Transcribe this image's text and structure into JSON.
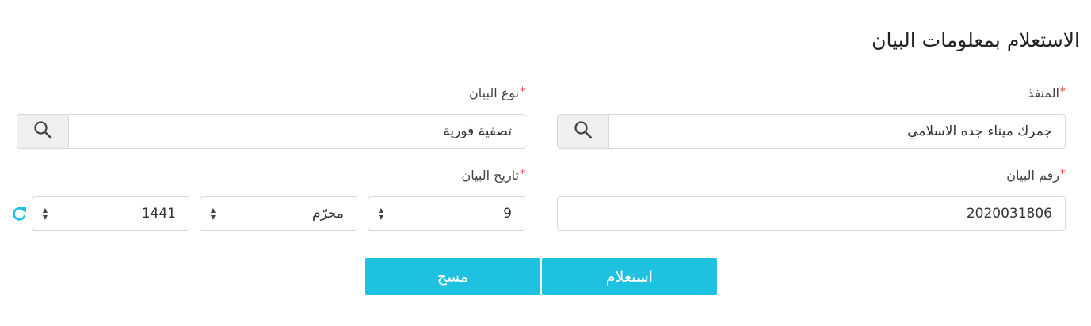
{
  "page": {
    "title": "الاستعلام بمعلومات البيان"
  },
  "port": {
    "label": "المنفذ",
    "required_mark": "*",
    "value": "جمرك ميناء جده الاسلامي"
  },
  "declaration_type": {
    "label": "نوع البيان",
    "required_mark": "*",
    "value": "تصفية فورية"
  },
  "declaration_number": {
    "label": "رقم البيان",
    "required_mark": "*",
    "value": "2020031806"
  },
  "declaration_date": {
    "label": "تاريخ البيان",
    "required_mark": "*",
    "day": "9",
    "month": "محرّم",
    "year": "1441"
  },
  "actions": {
    "inquiry_label": "استعلام",
    "clear_label": "مسح"
  },
  "colors": {
    "accent": "#1fc1e0",
    "required": "#e0453f"
  },
  "icons": [
    "search-icon",
    "refresh-icon",
    "spinner-arrows-icon"
  ]
}
